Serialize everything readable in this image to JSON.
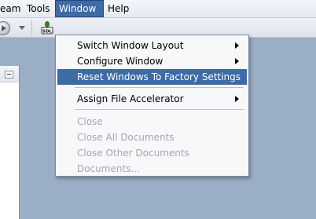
{
  "menubar": {
    "items": [
      {
        "label": "eam"
      },
      {
        "label": "Tools"
      },
      {
        "label": "Window"
      },
      {
        "label": "Help"
      }
    ]
  },
  "toolbar": {
    "sdl_icon_label": "SDL"
  },
  "window_menu": {
    "items": [
      {
        "label": "Switch Window Layout"
      },
      {
        "label": "Configure Window"
      },
      {
        "label": "Reset Windows To Factory Settings"
      },
      {
        "label": "Assign File Accelerator"
      },
      {
        "label": "Close"
      },
      {
        "label": "Close All Documents"
      },
      {
        "label": "Close Other Documents"
      },
      {
        "label": "Documents..."
      }
    ]
  },
  "colors": {
    "highlight": "#3e6aa5",
    "desktop": "#9aafc6",
    "disabled_text": "#a3a7ad"
  }
}
